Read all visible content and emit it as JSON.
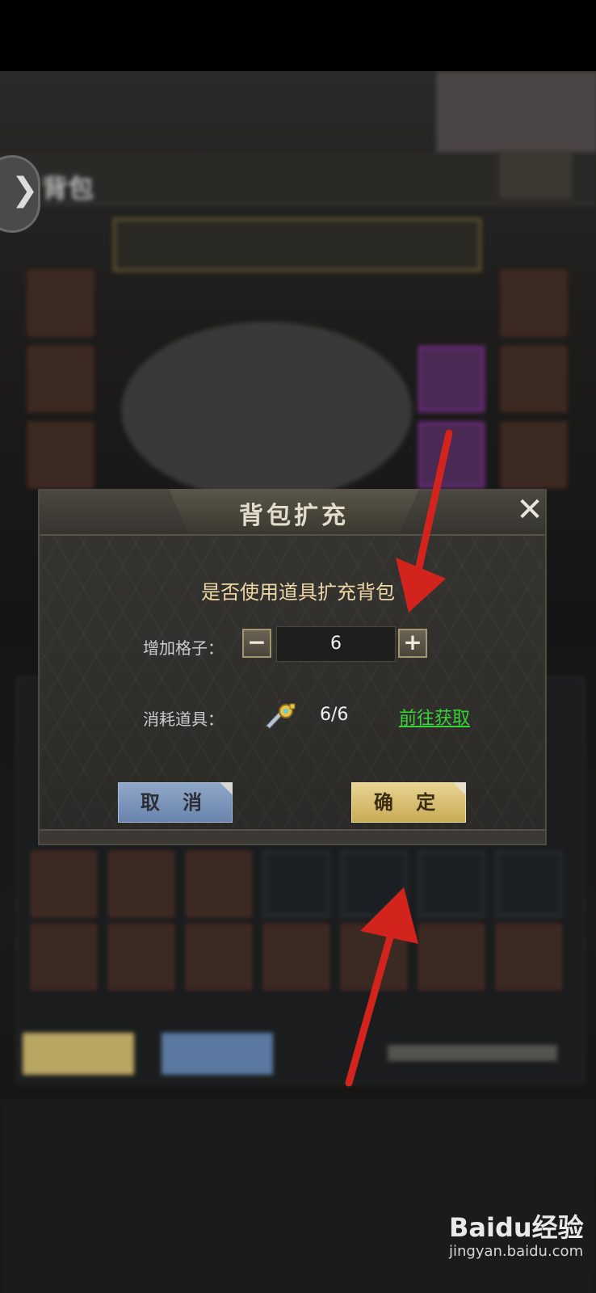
{
  "game_background": {
    "title": "背包"
  },
  "dialog": {
    "title": "背包扩充",
    "prompt": "是否使用道具扩充背包",
    "add_slots_label": "增加格子：",
    "quantity_value": "6",
    "minus_label": "−",
    "plus_label": "+",
    "consume_label": "消耗道具：",
    "item_icon": "wrench-key-icon",
    "item_count": "6/6",
    "goto_link": "前往获取",
    "cancel_button": "取 消",
    "confirm_button": "确 定",
    "close_icon": "close-x-icon"
  },
  "annotations": {
    "arrow_color": "#d2241c"
  },
  "watermark": {
    "logo_text": "Baidu经验",
    "url": "jingyan.baidu.com"
  }
}
